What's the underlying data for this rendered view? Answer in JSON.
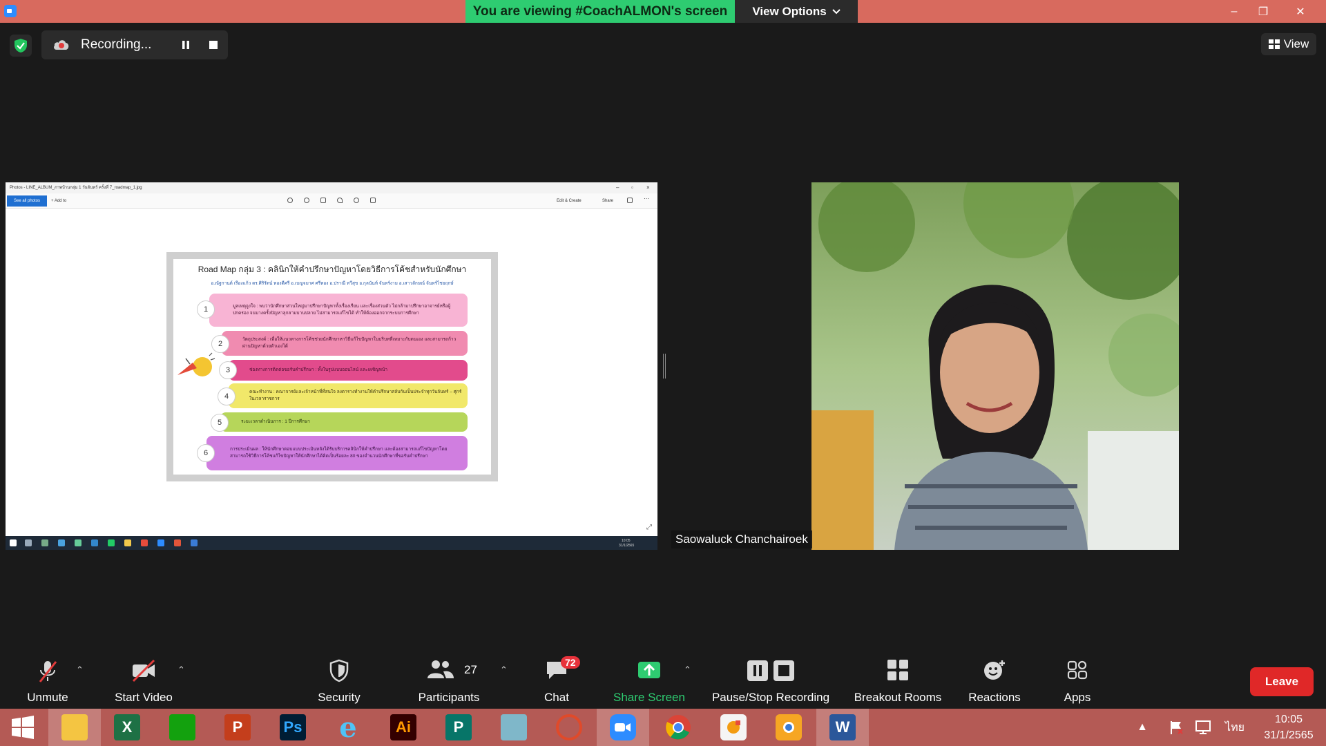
{
  "window": {
    "viewing_banner": "You are viewing #CoachALMON's screen",
    "view_options": "View Options",
    "minimize": "–",
    "restore": "❐",
    "close": "✕"
  },
  "recording": {
    "label": "Recording...",
    "view_label": "View"
  },
  "shared_screen": {
    "photos_title": "Photos - LINE_ALBUM_ภาพบ้านกลุ่ม 1 วันจันทร์ ครั้งที่ 7_roadmap_1.jpg",
    "see_all_photos": "See all photos",
    "add_to": "Add to",
    "edit_create": "Edit & Create",
    "share": "Share",
    "roadmap": {
      "title": "Road Map กลุ่ม 3 : คลินิกให้คำปรึกษาปัญหาโดยวิธีการโค้ชสำหรับนักศึกษา",
      "names": "อ.ณัฐกานต์ เรืองแก้ว  ดร.ศิริรัตน์ ทองดีศรี  อ.เบญจมาศ ศรีทอง  อ.ปราณี ทวีสุข  อ.กุลนันท์ จันทร์งาม  อ.เสาวลักษณ์ จันทร์ไชยฤกษ์",
      "rows": [
        {
          "num": "1",
          "text": "มูลเหตุจูงใจ : พบว่านักศึกษาส่วนใหญ่มาปรึกษาปัญหาทั้งเรื่องเรียน และเรื่องส่วนตัว ไม่กล้ามาปรึกษาอาจารย์หรือผู้ปกครอง จนบางครั้งปัญหาลุกลามบานปลาย ไม่สามารถแก้ไขได้ ทำให้ต้องออกจากระบบการศึกษา"
        },
        {
          "num": "2",
          "text": "วัตถุประสงค์ : เพื่อให้แนวทางการโค้ชช่วยนักศึกษาหาวิธีแก้ไขปัญหาในบริบทที่เหมาะกับตนเอง และสามารถก้าวผ่านปัญหาด้วยตัวเองได้"
        },
        {
          "num": "3",
          "text": "ช่องทางการติดต่อขอรับคำปรึกษา : ทั้งในรูปแบบออนไลน์ และเผชิญหน้า"
        },
        {
          "num": "4",
          "text": "คณะทำงาน : คณาจารย์และเจ้าหน้าที่ที่สนใจ ลงตารางทำงานให้คำปรึกษาสลับกันเป็นประจำทุกวันจันทร์ – ศุกร์ ในเวลาราชการ"
        },
        {
          "num": "5",
          "text": "ระยะเวลาดำเนินการ : 1 ปีการศึกษา"
        },
        {
          "num": "6",
          "text": "การประเมินผล : ให้นักศึกษาตอบแบบประเมินหลังได้รับบริการคลินิกให้คำปรึกษา และต้องสามารถแก้ไขปัญหาโดยสามารถใช้วิธีการโค้ชแก้ไขปัญหาให้นักศึกษาได้คิดเป็นร้อยละ 80 ของจำนวนนักศึกษาที่ขอรับคำปรึกษา"
        }
      ]
    },
    "mini_clock": "10:05",
    "mini_date": "31/1/2565"
  },
  "participant": {
    "name": "Saowaluck Chanchairoek"
  },
  "toolbar": {
    "unmute": "Unmute",
    "start_video": "Start Video",
    "security": "Security",
    "participants": "Participants",
    "participants_count": "27",
    "chat": "Chat",
    "chat_badge": "72",
    "share_screen": "Share Screen",
    "pause_stop_recording": "Pause/Stop Recording",
    "breakout_rooms": "Breakout Rooms",
    "reactions": "Reactions",
    "apps": "Apps",
    "leave": "Leave"
  },
  "taskbar": {
    "lang": "ไทย",
    "time": "10:05",
    "date": "31/1/2565",
    "app_letters": {
      "excel": "X",
      "powerpoint": "P",
      "photoshop": "Ps",
      "illustrator": "Ai",
      "publisher": "P",
      "word": "W"
    }
  },
  "colors": {
    "title_bar": "#d86a5e",
    "banner_green": "#2ecc71",
    "share_green": "#2ecc71",
    "leave_red": "#e02828",
    "taskbar": "#b45a55"
  }
}
